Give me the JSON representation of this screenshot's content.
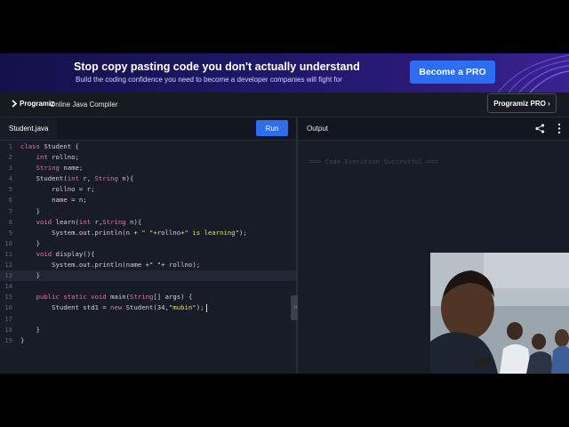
{
  "banner": {
    "headline": "Stop copy pasting code you don't actually understand",
    "subtext": "Build the coding confidence you need to become a developer companies will fight for",
    "cta_label": "Become a PRO"
  },
  "header": {
    "logo_text": "Programiz",
    "title": "Online Java Compiler",
    "pro_button_label": "Programiz PRO ›"
  },
  "editor": {
    "file_tab": "Student.java",
    "run_label": "Run",
    "active_line": 13,
    "lines": [
      "class Student {",
      "    int rollno;",
      "    String name;",
      "    Student(int r, String n){",
      "        rollno = r;",
      "        name = n;",
      "    }",
      "    void learn(int r,String n){",
      "        System.out.println(n + \" \"+rollno+\" is learning\");",
      "    }",
      "    void display(){",
      "        System.out.println(name +\" \"+ rollno);",
      "    }",
      "",
      "    public static void main(String[] args) {",
      "        Student std1 = new Student(34,\"mubin\");",
      "",
      "    }",
      "}"
    ]
  },
  "output": {
    "title": "Output",
    "text": "=== Code Execution Successful ===",
    "icons": [
      "share-icon",
      "more-vertical-icon"
    ]
  },
  "colors": {
    "accent": "#2c6ef2",
    "editor_bg": "#171c26",
    "banner_bg": "#1d1868"
  }
}
